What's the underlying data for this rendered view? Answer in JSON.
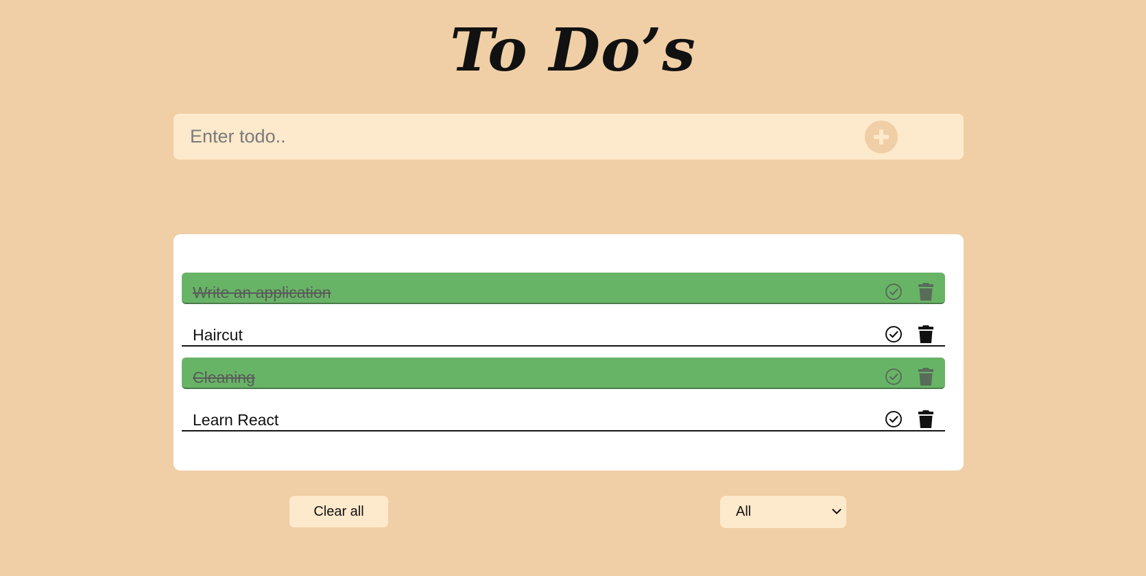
{
  "header": {
    "title": "To Do’s"
  },
  "input": {
    "placeholder": "Enter todo..",
    "value": "",
    "add_icon": "plus-icon"
  },
  "todos": [
    {
      "text": "Write an application",
      "completed": true
    },
    {
      "text": "Haircut",
      "completed": false
    },
    {
      "text": "Cleaning",
      "completed": true
    },
    {
      "text": "Learn React",
      "completed": false
    }
  ],
  "icons": {
    "complete": "check-circle-icon",
    "delete": "trash-icon",
    "dropdown": "chevron-down-icon"
  },
  "footer": {
    "clear_label": "Clear all",
    "filter": {
      "selected": "All"
    }
  },
  "colors": {
    "background": "#f0cfa6",
    "input_background": "#fde9cb",
    "card_background": "#ffffff",
    "completed_row": "#68b467",
    "text": "#111111"
  }
}
